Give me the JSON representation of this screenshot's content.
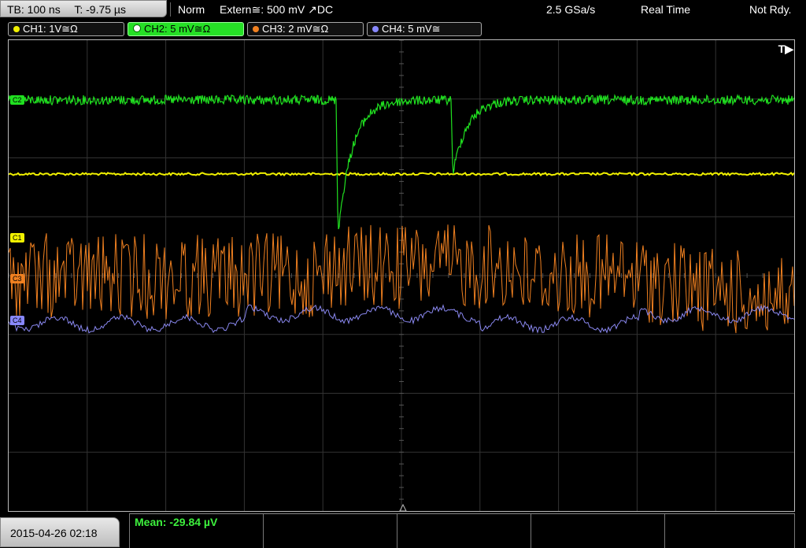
{
  "timebase": {
    "tb": "TB: 100 ns",
    "t": "T: -9.75 µs"
  },
  "status": {
    "mode": "Norm",
    "trigger": "Extern≅: 500 mV ↗DC",
    "rate": "2.5 GSa/s",
    "acq": "Real Time",
    "ready": "Not Rdy."
  },
  "channels": [
    {
      "label": "CH1: 1V≅Ω",
      "color": "#f0f000"
    },
    {
      "label": "CH2: 5 mV≅Ω",
      "color": "#20e020"
    },
    {
      "label": "CH3: 2 mV≅Ω",
      "color": "#f08020"
    },
    {
      "label": "CH4: 5 mV≅",
      "color": "#8888ff"
    }
  ],
  "trigger_marker": "T▶",
  "trace_labels": {
    "c1": "C1",
    "c3": "C3",
    "c4": "C4",
    "c2": "C2"
  },
  "date": "2015-04-26 02:18",
  "measurement": "Mean: -29.84 µV"
}
